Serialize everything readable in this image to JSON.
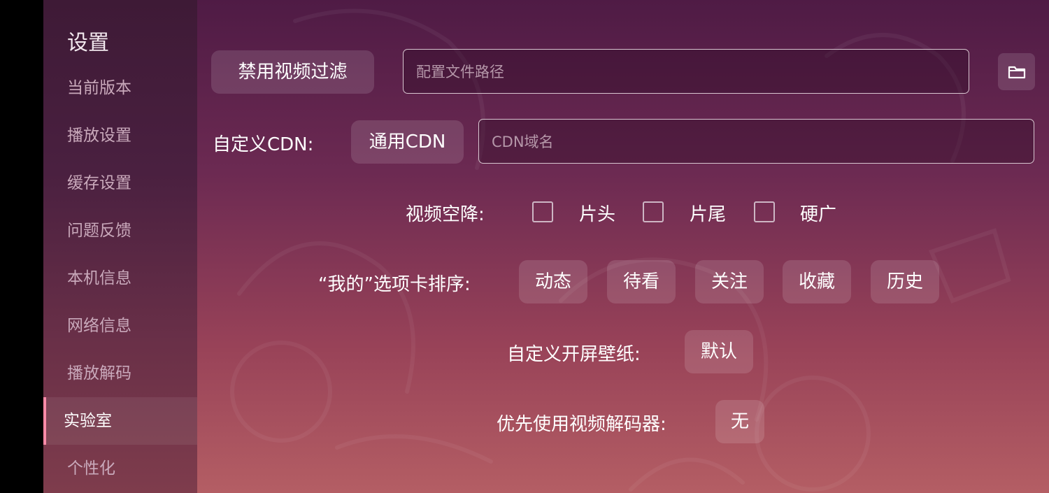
{
  "sidebar": {
    "title": "设置",
    "items": [
      {
        "label": "当前版本"
      },
      {
        "label": "播放设置"
      },
      {
        "label": "缓存设置"
      },
      {
        "label": "问题反馈"
      },
      {
        "label": "本机信息"
      },
      {
        "label": "网络信息"
      },
      {
        "label": "播放解码"
      },
      {
        "label": "实验室",
        "active": true
      },
      {
        "label": "个性化"
      }
    ]
  },
  "lab": {
    "filter_button": "禁用视频过滤",
    "config_path": {
      "placeholder": "配置文件路径",
      "value": ""
    },
    "folder_icon": "folder-icon",
    "cdn_label": "自定义CDN:",
    "cdn_button": "通用CDN",
    "cdn_domain": {
      "placeholder": "CDN域名",
      "value": ""
    },
    "skip_label": "视频空降:",
    "skip_options": [
      {
        "label": "片头",
        "checked": false
      },
      {
        "label": "片尾",
        "checked": false
      },
      {
        "label": "硬广",
        "checked": false
      }
    ],
    "tab_order_label": "“我的”选项卡排序:",
    "tab_order": [
      "动态",
      "待看",
      "关注",
      "收藏",
      "历史"
    ],
    "wallpaper_label": "自定义开屏壁纸:",
    "wallpaper_button": "默认",
    "decoder_label": "优先使用视频解码器:",
    "decoder_button": "无"
  },
  "colors": {
    "sidebar_bg": "#4a2040",
    "main_bg_top": "#4f1b45",
    "main_bg_bottom": "#b45e64",
    "active_indicator": "#ff8aa8"
  }
}
